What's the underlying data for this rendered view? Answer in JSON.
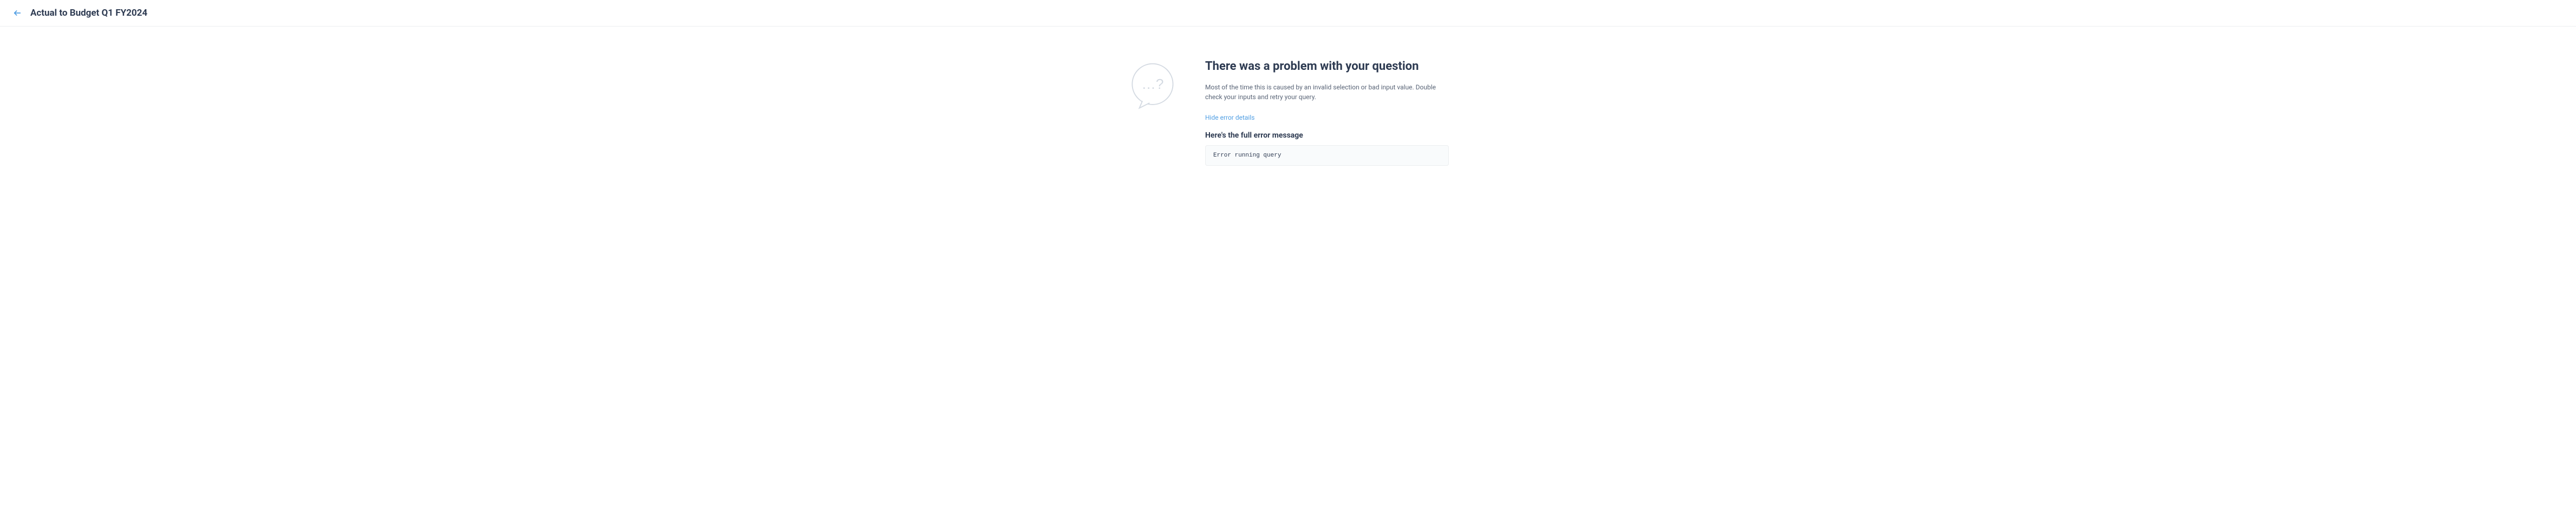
{
  "header": {
    "title": "Actual to Budget Q1 FY2024"
  },
  "error": {
    "title": "There was a problem with your question",
    "description": "Most of the time this is caused by an invalid selection or bad input value. Double check your inputs and retry your query.",
    "hide_link": "Hide error details",
    "full_heading": "Here's the full error message",
    "message": "Error running query"
  }
}
